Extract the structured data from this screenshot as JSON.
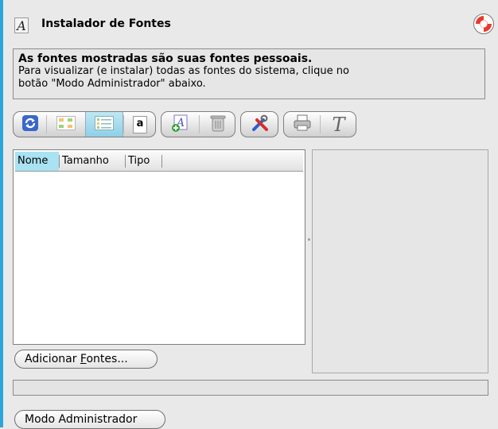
{
  "window": {
    "title": "Instalador de Fontes"
  },
  "info": {
    "line1": "As fontes mostradas são suas fontes pessoais.",
    "line2": "Para visualizar (e instalar) todas as fontes do sistema, clique no",
    "line3": "botão \"Modo Administrador\" abaixo."
  },
  "toolbar": {
    "text_preview_glyph": "a",
    "font_editor_glyph": "T"
  },
  "list": {
    "columns": [
      "Nome",
      "Tamanho",
      "Tipo"
    ],
    "sorted_column": "Nome",
    "rows": []
  },
  "buttons": {
    "add_fonts_pre": "Adicionar ",
    "add_fonts_mnemonic": "F",
    "add_fonts_post": "ontes...",
    "admin_mode": "Modo Administrador"
  },
  "progress": {
    "value": 0
  },
  "icons": {
    "app": "font-installer-icon",
    "help": "help-lifebuoy-icon",
    "refresh": "refresh-icon",
    "icon_view": "icon-view-icon",
    "list_view": "list-view-icon",
    "text_preview": "text-preview-icon",
    "add_font": "add-font-icon",
    "delete": "trash-icon",
    "configure": "tools-icon",
    "print": "printer-icon",
    "font_editor": "font-editor-icon"
  },
  "colors": {
    "accent": "#2aa6da",
    "selected_column": "#a9e2f2",
    "active_toggle": "#8dd0e8"
  }
}
